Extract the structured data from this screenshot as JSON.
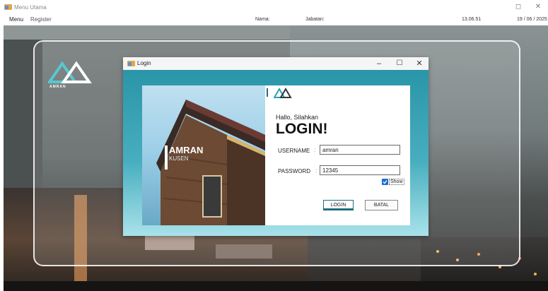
{
  "window": {
    "title": "Menu Utama"
  },
  "menu": {
    "items": [
      "Menu",
      "Register"
    ]
  },
  "info": {
    "name_label": "Nama:",
    "jabatan_label": "Jabatan:",
    "time": "13.06.51",
    "date": "19 / 06 / 2025"
  },
  "bg_logo": {
    "brand": "AMRAN"
  },
  "dialog": {
    "title": "Login",
    "brand_name": "AMRAN",
    "brand_sub": "KUSEN",
    "greeting": "Hallo, Silahkan",
    "heading": "LOGIN!",
    "username_label": "USERNAME",
    "password_label": "PASSWORD",
    "colon": ":",
    "username_value": "amran",
    "password_value": "12345",
    "show_label": "Show",
    "show_checked": true,
    "login_button": "LOGIN",
    "cancel_button": "BATAL"
  },
  "colors": {
    "accent": "#1f6f7d",
    "dialog_bg": "#4fb3c3",
    "checkbox": "#1e6fd0"
  },
  "icons": [
    "app-icon",
    "minimize-icon",
    "maximize-icon",
    "close-icon",
    "amran-logo-icon",
    "checkbox-icon"
  ]
}
